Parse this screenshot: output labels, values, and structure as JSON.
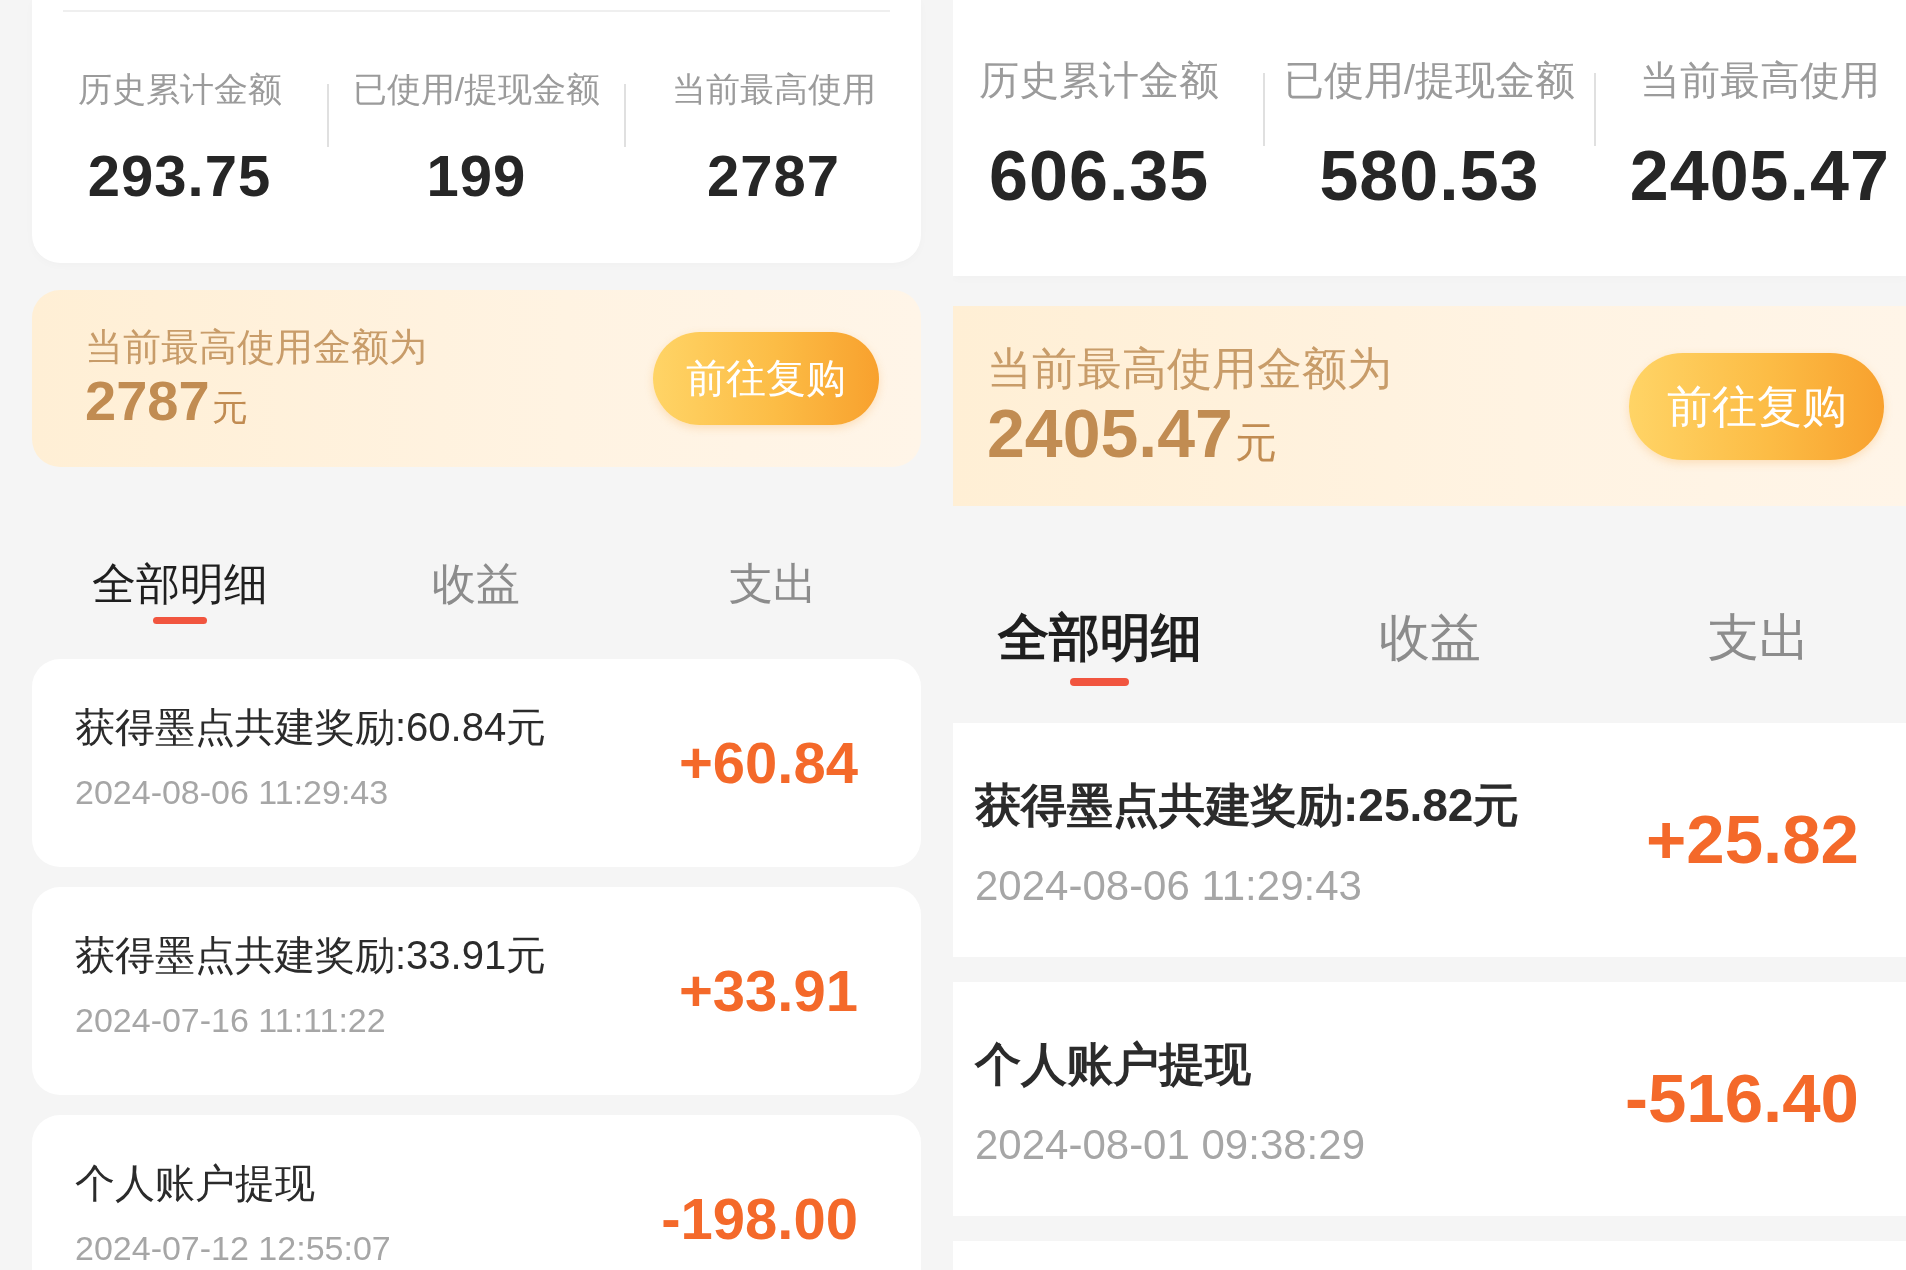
{
  "panels": [
    {
      "kind": "inset",
      "stats": [
        {
          "label": "历史累计金额",
          "value": "293.75"
        },
        {
          "label": "已使用/提现金额",
          "value": "199"
        },
        {
          "label": "当前最高使用",
          "value": "2787"
        }
      ],
      "banner": {
        "text": "当前最高使用金额为",
        "amount": "2787",
        "unit": "元",
        "button": "前往复购"
      },
      "tabs": [
        {
          "label": "全部明细",
          "selected": true
        },
        {
          "label": "收益",
          "selected": false
        },
        {
          "label": "支出",
          "selected": false
        }
      ],
      "transactions": [
        {
          "title": "获得墨点共建奖励:60.84元",
          "time": "2024-08-06 11:29:43",
          "amount": "+60.84"
        },
        {
          "title": "获得墨点共建奖励:33.91元",
          "time": "2024-07-16 11:11:22",
          "amount": "+33.91"
        },
        {
          "title": "个人账户提现",
          "time": "2024-07-12 12:55:07",
          "amount": "-198.00"
        }
      ]
    },
    {
      "kind": "fullbleed",
      "stats": [
        {
          "label": "历史累计金额",
          "value": "606.35"
        },
        {
          "label": "已使用/提现金额",
          "value": "580.53"
        },
        {
          "label": "当前最高使用",
          "value": "2405.47"
        }
      ],
      "banner": {
        "text": "当前最高使用金额为",
        "amount": "2405.47",
        "unit": "元",
        "button": "前往复购"
      },
      "tabs": [
        {
          "label": "全部明细",
          "selected": true
        },
        {
          "label": "收益",
          "selected": false
        },
        {
          "label": "支出",
          "selected": false
        }
      ],
      "transactions": [
        {
          "title": "获得墨点共建奖励:25.82元",
          "time": "2024-08-06 11:29:43",
          "amount": "+25.82"
        },
        {
          "title": "个人账户提现",
          "time": "2024-08-01 09:38:29",
          "amount": "-516.40"
        }
      ]
    }
  ]
}
